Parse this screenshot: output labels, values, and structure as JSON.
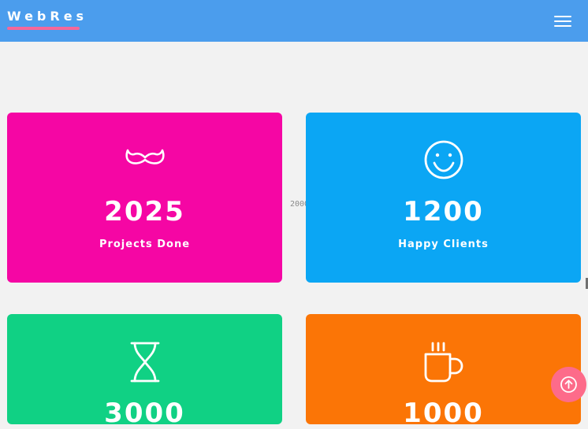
{
  "navbar": {
    "brand": "WebRes",
    "menu_icon": "hamburger-menu-icon",
    "background_color": "#4b9ded",
    "brand_underline_color": "#f4679a"
  },
  "background_text": {
    "year": "2000"
  },
  "stats": [
    {
      "icon": "mustache-icon",
      "number": "2025",
      "label": "Projects Done",
      "color": "#f506a4"
    },
    {
      "icon": "smiley-face-icon",
      "number": "1200",
      "label": "Happy Clients",
      "color": "#0ba6f4"
    },
    {
      "icon": "hourglass-icon",
      "number": "3000",
      "label": "",
      "color": "#10d184"
    },
    {
      "icon": "coffee-cup-icon",
      "number": "1000",
      "label": "",
      "color": "#fb7506"
    }
  ],
  "scroll_top_button": {
    "icon": "arrow-up-circle-icon",
    "color": "#fd6b8a"
  }
}
